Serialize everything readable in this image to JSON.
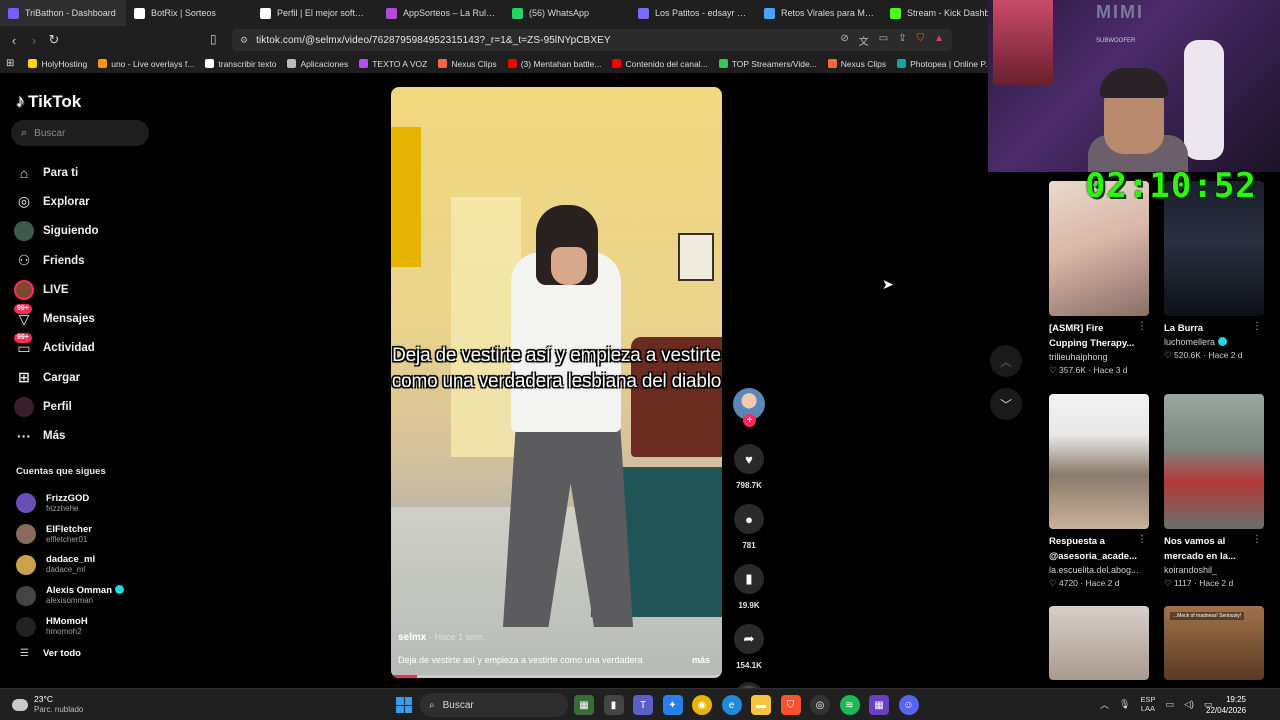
{
  "browser": {
    "tabs": [
      {
        "title": "TriBathon - Dashboard",
        "color": "#7a5cff"
      },
      {
        "title": "BotRix | Sorteos",
        "color": "#ffffff"
      },
      {
        "title": "Perfil | El mejor software p",
        "color": "#ffffff"
      },
      {
        "title": "AppSorteos – La Ruleta de",
        "color": "#b24bd6"
      },
      {
        "title": "(56) WhatsApp",
        "color": "#25d366"
      },
      {
        "title": "Los Patitos - edsayr quisp",
        "color": "#7b6cf6"
      },
      {
        "title": "Retos Virales para Mobile",
        "color": "#4aa3ff"
      },
      {
        "title": "Stream - Kick Dashbo",
        "color": "#53fc18"
      }
    ],
    "url": "tiktok.com/@selmx/video/7628795984952315143?_r=1&_t=ZS-95lNYpCBXEY",
    "bookmarks": [
      {
        "label": "HolyHosting",
        "color": "#ffd400"
      },
      {
        "label": "uno - Live overlays f...",
        "color": "#ff9500"
      },
      {
        "label": "transcribir texto",
        "color": "#ffffff"
      },
      {
        "label": "Aplicaciones",
        "color": "#bbbbbb"
      },
      {
        "label": "TEXTO A VOZ",
        "color": "#b84dff"
      },
      {
        "label": "Nexus Clips",
        "color": "#ff6a3d"
      },
      {
        "label": "(3) Mentahan battle...",
        "color": "#ff0000"
      },
      {
        "label": "Contenido del canal...",
        "color": "#ff0000"
      },
      {
        "label": "TOP Streamers/Vide...",
        "color": "#34c759"
      },
      {
        "label": "Nexus Clips",
        "color": "#ff6a3d"
      },
      {
        "label": "Photopea | Online P...",
        "color": "#18a497"
      }
    ]
  },
  "tiktok": {
    "logo": "TikTok",
    "search_placeholder": "Buscar",
    "nav": [
      {
        "label": "Para ti",
        "icon": "home-icon",
        "glyph": "⌂"
      },
      {
        "label": "Explorar",
        "icon": "compass-icon",
        "glyph": "◎"
      },
      {
        "label": "Siguiendo",
        "icon": "following-icon",
        "glyph": "●"
      },
      {
        "label": "Friends",
        "icon": "friends-icon",
        "glyph": "⚇"
      },
      {
        "label": "LIVE",
        "icon": "live-icon",
        "glyph": "●"
      },
      {
        "label": "Mensajes",
        "icon": "messages-icon",
        "glyph": "▽",
        "badge": "99+"
      },
      {
        "label": "Actividad",
        "icon": "activity-icon",
        "glyph": "▭",
        "badge": "99+"
      },
      {
        "label": "Cargar",
        "icon": "upload-icon",
        "glyph": "⊞"
      },
      {
        "label": "Perfil",
        "icon": "profile-icon",
        "glyph": "●"
      },
      {
        "label": "Más",
        "icon": "more-icon",
        "glyph": "···"
      }
    ],
    "following_title": "Cuentas que sigues",
    "following": [
      {
        "name": "FrizzGOD",
        "handle": "frizzhehe",
        "color": "#6b4fb8",
        "verified": false
      },
      {
        "name": "ElFletcher",
        "handle": "elfletcher01",
        "color": "#8a6a5a",
        "verified": false
      },
      {
        "name": "dadace_ml",
        "handle": "dadace_ml",
        "color": "#c9a24a",
        "verified": false
      },
      {
        "name": "Alexis Omman",
        "handle": "alexisomman",
        "color": "#444444",
        "verified": true
      },
      {
        "name": "HMomoH",
        "handle": "hmomoh2",
        "color": "#222222",
        "verified": false
      }
    ],
    "see_all": "Ver todo",
    "video": {
      "caption_overlay": "Deja de vestirte así y empieza a vestirte como una verdadera lesbiana del diablo",
      "author": "selmx",
      "posted": "· Hace 1 sem.",
      "description": "Deja de vestirte así y empieza a vestirte como una verdadera",
      "more": "más",
      "progress": 0.08
    },
    "actions": {
      "likes": "798.7K",
      "comments": "781",
      "saves": "19.9K",
      "shares": "154.1K"
    }
  },
  "overlay": {
    "timer": "02:10:52",
    "brand": "MIMI",
    "brand_sub": "SUBWOOFER"
  },
  "recommendations": [
    {
      "title": "[ASMR] Fire Cupping Therapy...",
      "author": "trilieuhaiphong",
      "likes": "357.6K",
      "age": "Hace 3 d",
      "verified": false,
      "bg": "linear-gradient(160deg,#e9d9cc 0%,#d9b8a8 45%,#8a6f66 100%)"
    },
    {
      "title": "La Burra",
      "author": "luchomellera",
      "likes": "520.6K",
      "age": "Hace 2 d",
      "verified": true,
      "bg": "linear-gradient(180deg,#1a1f2e 0%,#2a3040 45%,#0e1118 100%)"
    },
    {
      "title": "Respuesta a @asesoria_acade...",
      "author": "la.escuelita.del.abog...",
      "likes": "4720",
      "age": "Hace 2 d",
      "verified": false,
      "bg": "linear-gradient(180deg,#f2f2f2 0%,#e8e8e8 30%,#8a7a6a 60%,#c9b39a 100%)"
    },
    {
      "title": "Nos vamos al mercado en la...",
      "author": "koirandoshil_",
      "likes": "1117",
      "age": "Hace 2 d",
      "verified": false,
      "bg": "linear-gradient(180deg,#9aa7a0 0%,#7c8680 40%,#b33a3a 65%,#6a6f6a 100%)"
    },
    {
      "title": "",
      "author": "",
      "likes": "",
      "age": "",
      "verified": false,
      "bg": "linear-gradient(180deg,#d8cfc8,#a99a90)"
    },
    {
      "title": "",
      "author": "",
      "likes": "",
      "age": "",
      "verified": false,
      "bg": "linear-gradient(180deg,#a0724a,#5a3a24)"
    }
  ],
  "rec_thumb_texts": [
    "...Meck of madness! Seriously!"
  ],
  "taskbar": {
    "temperature": "23°C",
    "condition": "Parc. nublado",
    "search": "Buscar",
    "lang_top": "ESP",
    "lang_bottom": "LAA",
    "time": "19:25",
    "date": "22/04/2026"
  },
  "colors": {
    "accent": "#fe2c55",
    "verified": "#20d5ec",
    "timer": "#2cf70a"
  }
}
